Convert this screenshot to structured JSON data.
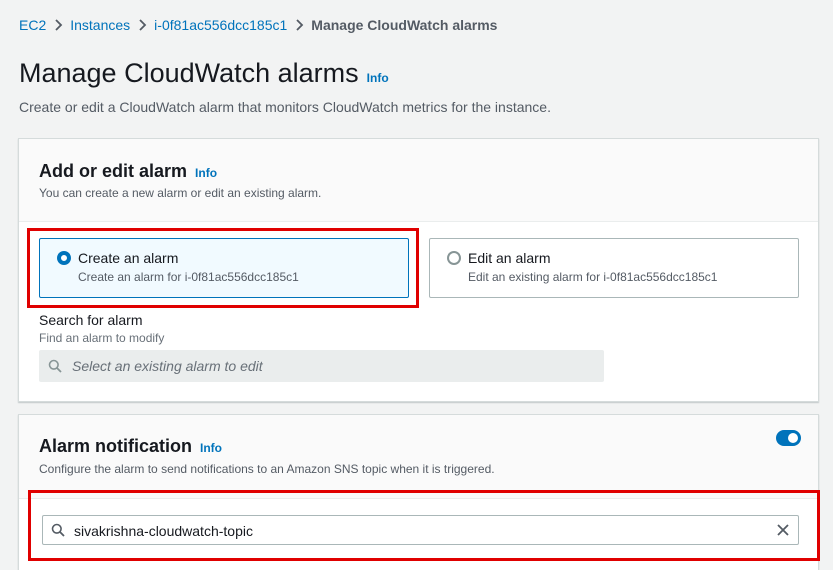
{
  "breadcrumb": {
    "items": [
      "EC2",
      "Instances",
      "i-0f81ac556dcc185c1"
    ],
    "current": "Manage CloudWatch alarms"
  },
  "page": {
    "title": "Manage CloudWatch alarms",
    "info": "Info",
    "description": "Create or edit a CloudWatch alarm that monitors CloudWatch metrics for the instance."
  },
  "add_edit": {
    "title": "Add or edit alarm",
    "info": "Info",
    "description": "You can create a new alarm or edit an existing alarm.",
    "options": [
      {
        "label": "Create an alarm",
        "sublabel": "Create an alarm for i-0f81ac556dcc185c1",
        "selected": true
      },
      {
        "label": "Edit an alarm",
        "sublabel": "Edit an existing alarm for i-0f81ac556dcc185c1",
        "selected": false
      }
    ],
    "search": {
      "label": "Search for alarm",
      "description": "Find an alarm to modify",
      "placeholder": "Select an existing alarm to edit"
    }
  },
  "notification": {
    "title": "Alarm notification",
    "info": "Info",
    "description": "Configure the alarm to send notifications to an Amazon SNS topic when it is triggered.",
    "enabled": true,
    "topic_value": "sivakrishna-cloudwatch-topic"
  },
  "colors": {
    "link": "#0073bb",
    "highlight": "#e00000",
    "toggle_on": "#0073bb"
  }
}
